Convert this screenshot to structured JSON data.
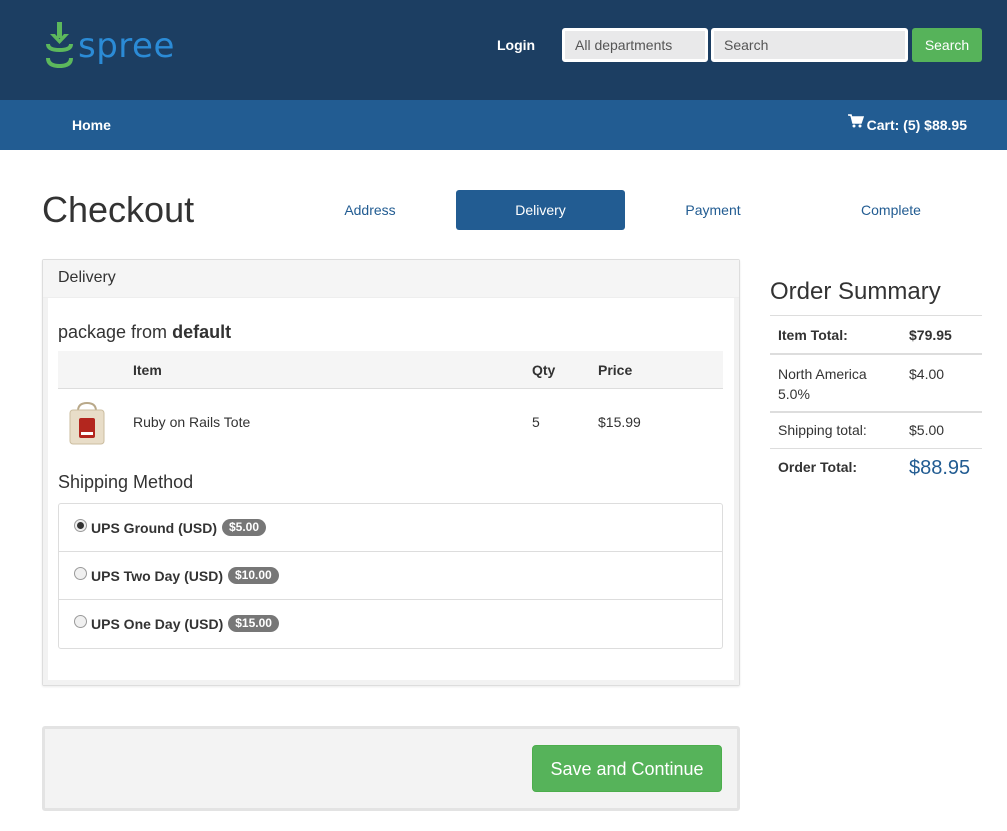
{
  "header": {
    "logo_text": "spree",
    "login_label": "Login",
    "department_select": "All departments",
    "search_placeholder": "Search",
    "search_button": "Search"
  },
  "nav": {
    "home": "Home",
    "cart_label": "Cart: (5) $88.95"
  },
  "checkout": {
    "title": "Checkout",
    "steps": [
      "Address",
      "Delivery",
      "Payment",
      "Complete"
    ],
    "active_step": "Delivery"
  },
  "delivery": {
    "panel_title": "Delivery",
    "package_prefix": "package from",
    "package_source": "default",
    "table_headers": {
      "item": "Item",
      "qty": "Qty",
      "price": "Price"
    },
    "items": [
      {
        "name": "Ruby on Rails Tote",
        "qty": "5",
        "price": "$15.99",
        "image_icon": "tote-bag-icon"
      }
    ],
    "shipping_title": "Shipping Method",
    "shipping_methods": [
      {
        "label": "UPS Ground (USD)",
        "price": "$5.00",
        "selected": true
      },
      {
        "label": "UPS Two Day (USD)",
        "price": "$10.00",
        "selected": false
      },
      {
        "label": "UPS One Day (USD)",
        "price": "$15.00",
        "selected": false
      }
    ]
  },
  "summary": {
    "title": "Order Summary",
    "item_total_label": "Item Total:",
    "item_total": "$79.95",
    "tax_label_line1": "North America",
    "tax_label_line2": "5.0%",
    "tax_value": "$4.00",
    "shipping_label": "Shipping total:",
    "shipping_value": "$5.00",
    "order_total_label": "Order Total:",
    "order_total": "$88.95"
  },
  "actions": {
    "save_button": "Save and Continue"
  },
  "colors": {
    "header_bg": "#1c3e62",
    "navbar_bg": "#225c92",
    "accent_green": "#56b35a",
    "link_blue": "#225c92"
  }
}
